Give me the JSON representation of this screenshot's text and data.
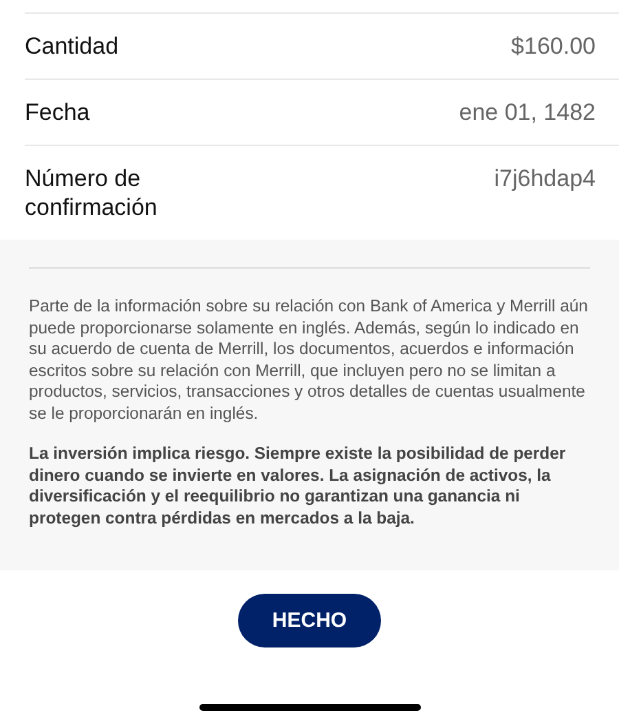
{
  "details": [
    {
      "label": "Cantidad",
      "value": "$160.00"
    },
    {
      "label": "Fecha",
      "value": "ene 01, 1482"
    },
    {
      "label": "Número de confirmación",
      "value": "i7j6hdap4"
    }
  ],
  "disclosures": [
    {
      "kind": "regular",
      "text": "Parte de la información sobre su relación con Bank of America y Merrill aún puede proporcionarse solamente en inglés. Además, según lo indicado en su acuerdo de cuenta de Merrill, los documentos, acuerdos e información escritos sobre su relación con Merrill, que incluyen pero no se limitan a productos, servicios, transacciones y otros detalles de cuentas usualmente se le proporcionarán en inglés."
    },
    {
      "kind": "bold",
      "text": "La inversión implica riesgo. Siempre existe la posibilidad de perder dinero cuando se invierte en valores. La asignación de activos, la diversificación y el reequilibrio no garantizan una ganancia ni protegen contra pérdidas en mercados a la baja."
    }
  ],
  "done_button": "HECHO"
}
